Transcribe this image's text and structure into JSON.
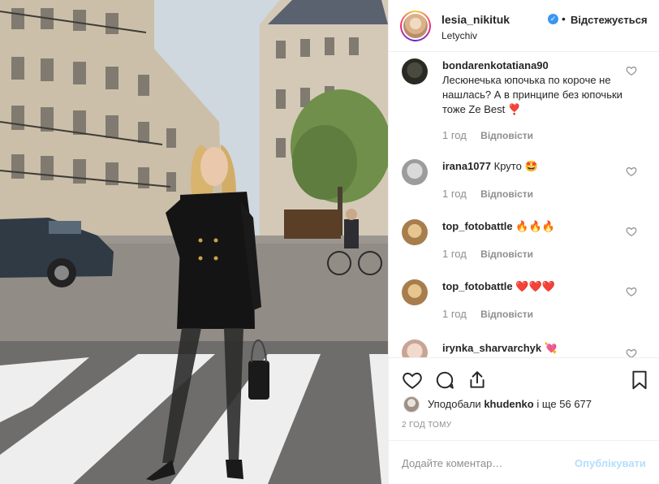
{
  "post": {
    "username": "lesia_nikituk",
    "follow_state": "Відстежується",
    "location": "Letychiv"
  },
  "comments": [
    {
      "username": "bondarenkotatiana90",
      "text": "Лесюнечька юпочька по короче не нашлась? А в принципе без юпочьки тоже Ze Best",
      "emoji": "❣️",
      "time": "1 год",
      "reply": "Відповісти"
    },
    {
      "username": "irana1077",
      "text": "Круто",
      "emoji": "🤩",
      "time": "1 год",
      "reply": "Відповісти"
    },
    {
      "username": "top_fotobattle",
      "text": "",
      "emoji": "🔥🔥🔥",
      "time": "1 год",
      "reply": "Відповісти"
    },
    {
      "username": "top_fotobattle",
      "text": "",
      "emoji": "❤️❤️❤️",
      "time": "1 год",
      "reply": "Відповісти"
    },
    {
      "username": "irynka_sharvarchyk",
      "text": "",
      "emoji": "💘",
      "time": "",
      "reply": ""
    }
  ],
  "likes": {
    "prefix": "Уподобали",
    "user": "khudenko",
    "and_more": "і ще 56 677"
  },
  "post_time": "2 ГОД ТОМУ",
  "add_comment": {
    "placeholder": "Додайте коментар…",
    "publish_label": "Опублікувати"
  },
  "icons": {
    "verified": "verified-badge-icon",
    "comment_like": "heart-outline-icon",
    "like": "heart-outline-icon",
    "comment": "speech-bubble-icon",
    "share": "share-arrow-icon",
    "save": "bookmark-icon"
  },
  "colors": {
    "link_blue": "#3897f0",
    "publish_disabled": "#b2dffc",
    "muted": "#8e8e8e",
    "text": "#262626"
  }
}
